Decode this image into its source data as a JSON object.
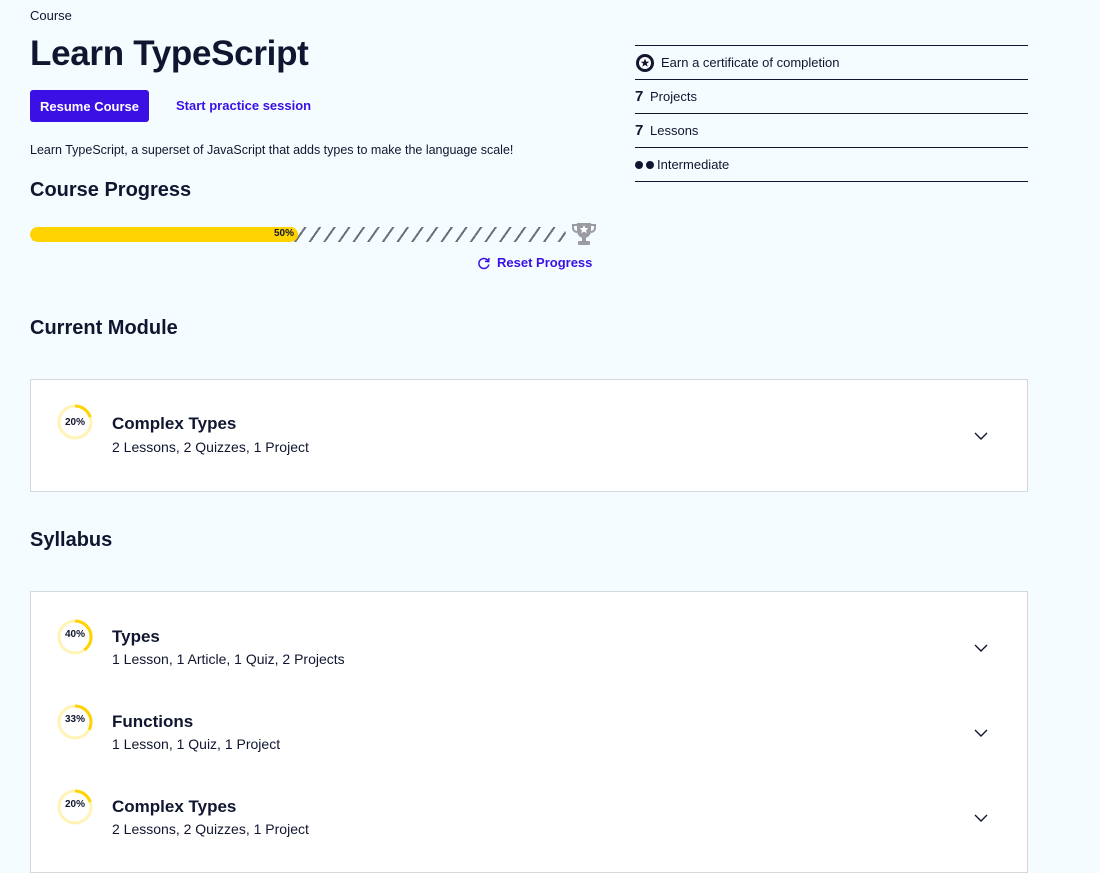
{
  "header": {
    "eyebrow": "Course",
    "title": "Learn TypeScript",
    "resume_label": "Resume Course",
    "practice_label": "Start practice session",
    "description": "Learn TypeScript, a superset of JavaScript that adds types to make the language scale!"
  },
  "stats": {
    "certificate": "Earn a certificate of completion",
    "projects_count": "7",
    "projects_label": "Projects",
    "lessons_count": "7",
    "lessons_label": "Lessons",
    "level": "Intermediate"
  },
  "progress": {
    "heading": "Course Progress",
    "percent_label": "50%",
    "percent_value": 0.5,
    "reset_label": "Reset Progress"
  },
  "current_module": {
    "heading": "Current Module",
    "percent_label": "20%",
    "percent_value": 0.2,
    "title": "Complex Types",
    "meta": "2 Lessons, 2 Quizzes, 1 Project"
  },
  "syllabus": {
    "heading": "Syllabus",
    "modules": [
      {
        "percent_label": "40%",
        "percent_value": 0.4,
        "title": "Types",
        "meta": "1 Lesson, 1 Article, 1 Quiz, 2 Projects"
      },
      {
        "percent_label": "33%",
        "percent_value": 0.33,
        "title": "Functions",
        "meta": "1 Lesson, 1 Quiz, 1 Project"
      },
      {
        "percent_label": "20%",
        "percent_value": 0.2,
        "title": "Complex Types",
        "meta": "2 Lessons, 2 Quizzes, 1 Project"
      }
    ]
  },
  "colors": {
    "accent": "#3a10e5",
    "progress": "#ffd300",
    "text": "#10162f",
    "background": "#f5fcff"
  },
  "icons": [
    "certificate-icon",
    "trophy-icon",
    "reset-icon",
    "chevron-down-icon",
    "progress-ring-icon"
  ]
}
